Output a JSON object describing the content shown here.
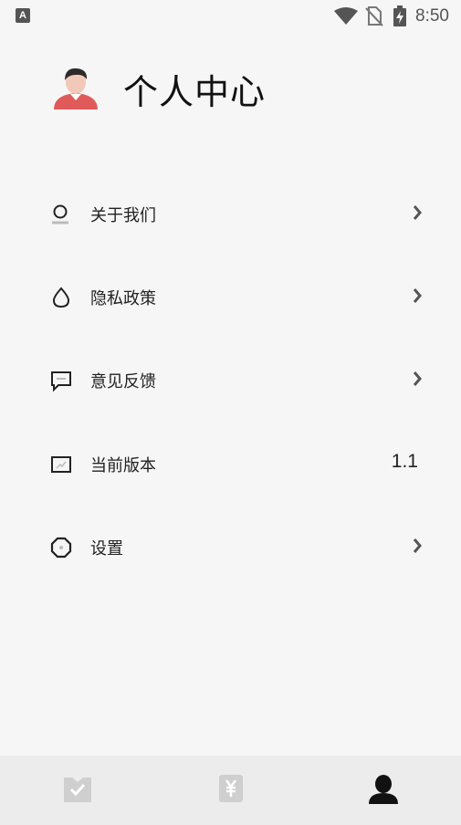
{
  "status_bar": {
    "app_icon_letter": "A",
    "time": "8:50",
    "icons": [
      "wifi-icon",
      "no-sim-icon",
      "battery-charging-icon"
    ]
  },
  "header": {
    "avatar_icon": "user-avatar-icon",
    "title": "个人中心"
  },
  "menu": {
    "items": [
      {
        "label": "关于我们",
        "icon": "about-icon",
        "chevron": "›"
      },
      {
        "label": "隐私政策",
        "icon": "privacy-drop-icon",
        "chevron": "›"
      },
      {
        "label": "意见反馈",
        "icon": "feedback-chat-icon",
        "chevron": "›"
      },
      {
        "label": "当前版本",
        "icon": "version-screen-icon",
        "value": "1.1"
      },
      {
        "label": "设置",
        "icon": "settings-octagon-icon",
        "chevron": "›"
      }
    ]
  },
  "tab_bar": {
    "tabs": [
      {
        "icon": "task-check-icon",
        "active": false
      },
      {
        "icon": "yuan-coupon-icon",
        "active": false
      },
      {
        "icon": "profile-person-icon",
        "active": true
      }
    ]
  },
  "colors": {
    "background": "#f6f6f6",
    "tab_bar_bg": "#ececec",
    "inactive_icon": "#cfcfcf",
    "active_icon": "#111111",
    "avatar_shirt": "#e05a5a"
  }
}
